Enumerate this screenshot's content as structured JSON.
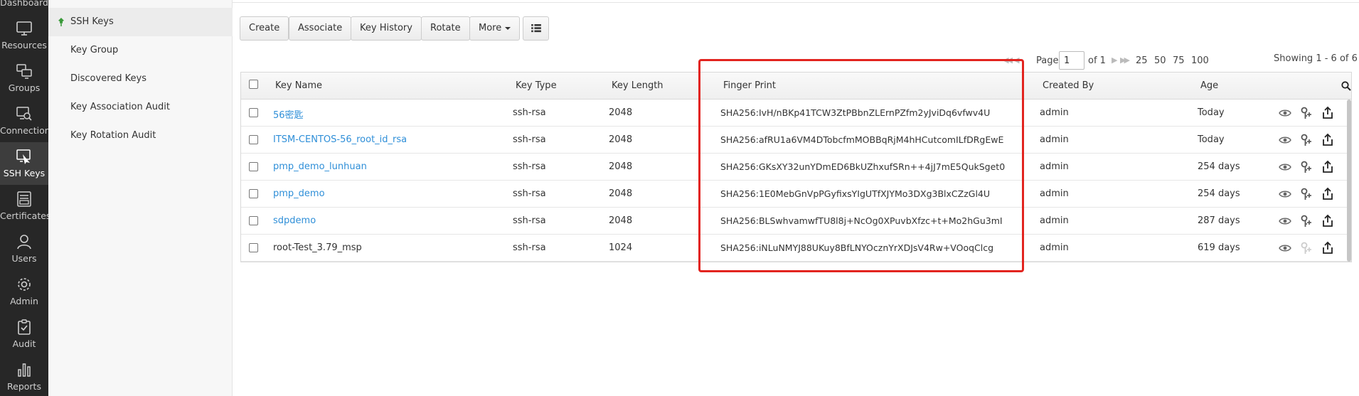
{
  "nav": {
    "top_partial": "Dashboard",
    "items": [
      {
        "label": "Resources",
        "icon": "monitor-icon"
      },
      {
        "label": "Groups",
        "icon": "groups-icon"
      },
      {
        "label": "Connection",
        "icon": "connection-icon"
      },
      {
        "label": "SSH Keys",
        "icon": "ssh-keys-icon",
        "active": true
      },
      {
        "label": "Certificates",
        "icon": "certificate-icon"
      },
      {
        "label": "Users",
        "icon": "user-icon"
      },
      {
        "label": "Admin",
        "icon": "gear-icon"
      },
      {
        "label": "Audit",
        "icon": "clipboard-check-icon"
      },
      {
        "label": "Reports",
        "icon": "bar-chart-icon"
      }
    ]
  },
  "subnav": {
    "items": [
      {
        "label": "SSH Keys",
        "active": true
      },
      {
        "label": "Key Group"
      },
      {
        "label": "Discovered Keys"
      },
      {
        "label": "Key Association Audit"
      },
      {
        "label": "Key Rotation Audit"
      }
    ]
  },
  "toolbar": {
    "create": "Create",
    "associate": "Associate",
    "key_history": "Key History",
    "rotate": "Rotate",
    "more": "More"
  },
  "pager": {
    "page_label": "Page",
    "current_page": "1",
    "of_label": "of 1",
    "page_sizes": [
      "25",
      "50",
      "75",
      "100"
    ],
    "showing": "Showing 1 - 6 of 6"
  },
  "table": {
    "columns": {
      "key_name": "Key Name",
      "key_type": "Key Type",
      "key_length": "Key Length",
      "finger_print": "Finger Print",
      "created_by": "Created By",
      "age": "Age"
    },
    "rows": [
      {
        "key_name": "56密匙",
        "link": true,
        "key_type": "ssh-rsa",
        "key_length": "2048",
        "finger_print": "SHA256:IvH/nBKp41TCW3ZtPBbnZLErnPZfm2yJviDq6vfwv4U",
        "created_by": "admin",
        "age": "Today"
      },
      {
        "key_name": "ITSM-CENTOS-56_root_id_rsa",
        "link": true,
        "key_type": "ssh-rsa",
        "key_length": "2048",
        "finger_print": "SHA256:afRU1a6VM4DTobcfmMOBBqRjM4hHCutcomILfDRgEwE",
        "created_by": "admin",
        "age": "Today"
      },
      {
        "key_name": "pmp_demo_lunhuan",
        "link": true,
        "key_type": "ssh-rsa",
        "key_length": "2048",
        "finger_print": "SHA256:GKsXY32unYDmED6BkUZhxufSRn++4jJ7mE5QukSget0",
        "created_by": "admin",
        "age": "254 days"
      },
      {
        "key_name": "pmp_demo",
        "link": true,
        "key_type": "ssh-rsa",
        "key_length": "2048",
        "finger_print": "SHA256:1E0MebGnVpPGyfixsYIgUTfXJYMo3DXg3BlxCZzGl4U",
        "created_by": "admin",
        "age": "254 days"
      },
      {
        "key_name": "sdpdemo",
        "link": true,
        "key_type": "ssh-rsa",
        "key_length": "2048",
        "finger_print": "SHA256:BLSwhvamwfTU8l8j+NcOg0XPuvbXfzc+t+Mo2hGu3mI",
        "created_by": "admin",
        "age": "287 days"
      },
      {
        "key_name": "root-Test_3.79_msp",
        "link": false,
        "key_type": "ssh-rsa",
        "key_length": "1024",
        "finger_print": "SHA256:iNLuNMYJ88UKuy8BfLNYOcznYrXDJsV4Rw+VOoqClcg",
        "created_by": "admin",
        "age": "619 days"
      }
    ]
  },
  "colors": {
    "highlight": "#e2241f",
    "link": "#2f8fd8",
    "nav_bg": "#272727"
  }
}
